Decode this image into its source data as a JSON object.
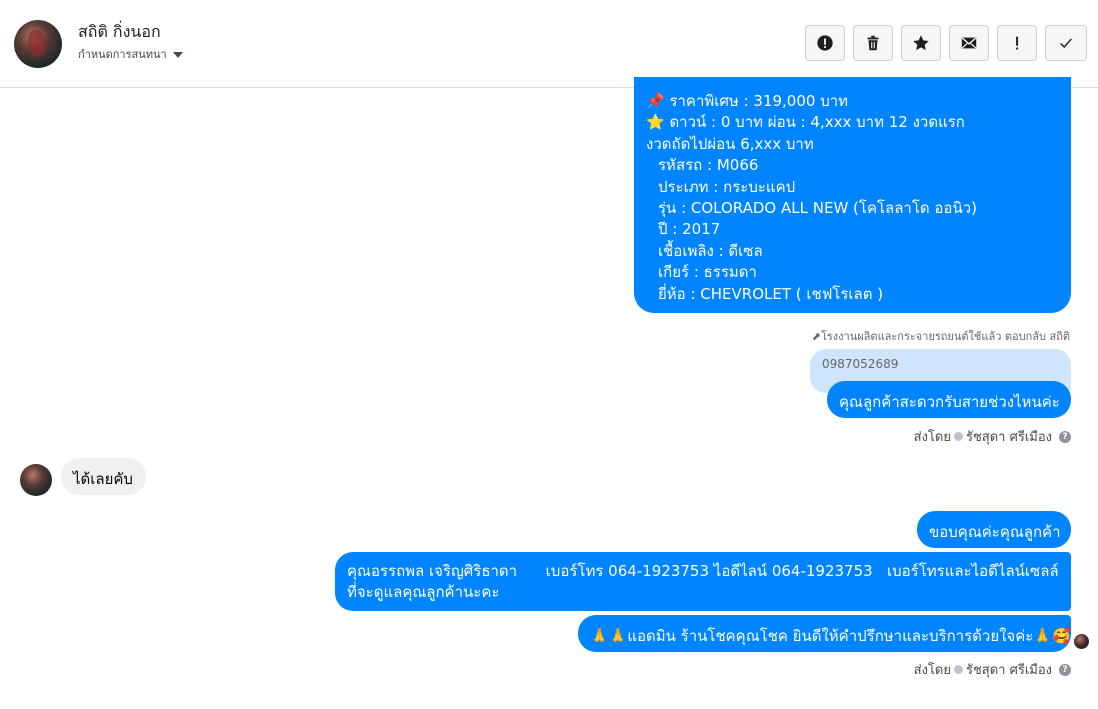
{
  "header": {
    "contact_name": "สถิติ กิ่งนอก",
    "conversation_settings": "กำหนดการสนทนา"
  },
  "toolbar": {
    "buttons": [
      {
        "name": "report-button",
        "icon": "alert-circle-icon"
      },
      {
        "name": "delete-button",
        "icon": "trash-icon"
      },
      {
        "name": "star-button",
        "icon": "star-icon"
      },
      {
        "name": "mark-unread-button",
        "icon": "envelope-icon"
      },
      {
        "name": "important-button",
        "icon": "exclamation-icon"
      },
      {
        "name": "done-button",
        "icon": "check-icon"
      }
    ]
  },
  "thread": {
    "car_listing": {
      "line1": "📌 ราคาพิเศษ : 319,000 บาท",
      "line2": "⭐ ดาวน์ : 0 บาท ผ่อน : 4,xxx บาท 12 งวดแรก",
      "line3": "งวดถัดไปผ่อน 6,xxx บาท",
      "line4": "รหัสรถ : M066",
      "line5": "ประเภท : กระบะแคป",
      "line6": "รุ่น : COLORADO ALL NEW (โคโลลาโด ออนิว)",
      "line7": "ปี : 2017",
      "line8": "เชื้อเพลิง : ดีเซล",
      "line9": "เกียร์ : ธรรมดา",
      "line10": "ยี่ห้อ : CHEVROLET ( เชฟโรเลต )"
    },
    "reply_note": "⬈โรงงานผลิตและกระจายรถยนต์ใช้แล้ว ตอบกลับ สถิติ",
    "quoted_text": "0987052689",
    "msg_ask_time": "คุณลูกค้าสะดวกรับสายช่วงไหนค่ะ",
    "sent_by_prefix": "ส่งโดย",
    "sent_by_name": "รัชสุดา ศรีเมือง",
    "incoming_msg": "ได้เลยคับ",
    "msg_thanks": "ขอบคุณค่ะคุณลูกค้า",
    "msg_contact": "คุณอรรถพล เจริญศิริธาดา      เบอร์โทร 064-1923753 ไอดีไลน์ 064-1923753   เบอร์โทรและไอดีไลน์เซลล์ที่จะดูแลคุณลูกค้านะคะ",
    "msg_admin": "🙏🙏แอดมิน ร้านโชคคุณโชค ยินดีให้คำปรึกษาและบริการด้วยใจค่ะ🙏🥰",
    "sent_by_prefix_2": "ส่งโดย",
    "sent_by_name_2": "รัชสุดา ศรีเมือง"
  }
}
